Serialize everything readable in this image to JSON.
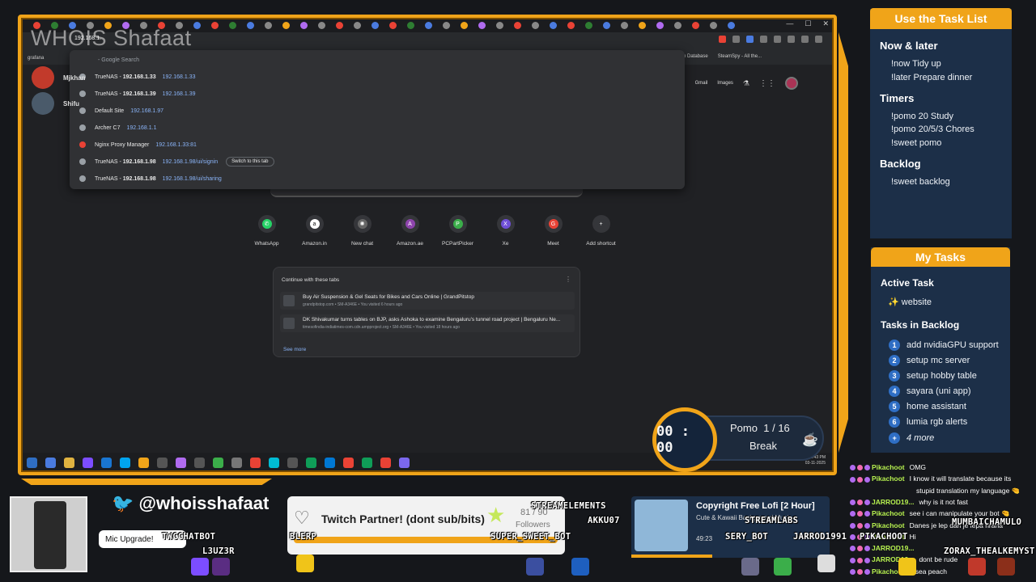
{
  "watermark": "WHOIS Shafaat",
  "omnibox": {
    "query": "192.168.1.",
    "rows": [
      {
        "title": "192.168.1.",
        "url": "",
        "suffix": "- Google Search"
      },
      {
        "title": "TrueNAS",
        "bold": "192.168.1.33",
        "url": "192.168.1.33"
      },
      {
        "title": "TrueNAS",
        "bold": "192.168.1.39",
        "url": "192.168.1.39"
      },
      {
        "title": "Default Site",
        "bold": "",
        "url": "192.168.1.97"
      },
      {
        "title": "Archer C7",
        "bold": "",
        "url": "192.168.1.1"
      },
      {
        "title": "Nginx Proxy Manager",
        "bold": "",
        "url": "192.168.1.33:81"
      },
      {
        "title": "TrueNAS",
        "bold": "192.168.1.98",
        "url": "192.168.1.98/ui/signin",
        "switch": "Switch to this tab"
      },
      {
        "title": "TrueNAS",
        "bold": "192.168.1.98",
        "url": "192.168.1.98/ui/sharing"
      }
    ]
  },
  "profiles": [
    {
      "name": "Mjkhan"
    },
    {
      "name": "Shifu"
    }
  ],
  "bookmark_left": "grafana",
  "bookmarks_right": [
    "n Database",
    "SteamSpy - All the..."
  ],
  "google_links": [
    "Gmail",
    "Images"
  ],
  "shortcuts": [
    {
      "label": "WhatsApp",
      "color": "#25d366",
      "glyph": "✆"
    },
    {
      "label": "Amazon.in",
      "color": "#ffffff",
      "glyph": "a"
    },
    {
      "label": "New chat",
      "color": "#666",
      "glyph": "✺"
    },
    {
      "label": "Amazon.ae",
      "color": "#8e44ad",
      "glyph": "A"
    },
    {
      "label": "PCPartPicker",
      "color": "#3bae4a",
      "glyph": "P"
    },
    {
      "label": "Xe",
      "color": "#6f4fd8",
      "glyph": "X"
    },
    {
      "label": "Meet",
      "color": "#e94235",
      "glyph": "G"
    },
    {
      "label": "Add shortcut",
      "color": "#35363a",
      "glyph": "+"
    }
  ],
  "continue": {
    "title": "Continue with these tabs",
    "items": [
      {
        "title": "Buy Air Suspension & Gel Seats for Bikes and Cars Online | GrandPitstop",
        "sub": "grandpitstop.com • SM-A346E • You visited 6 hours ago"
      },
      {
        "title": "DK Shivakumar turns tables on BJP, asks Ashoka to examine Bengaluru's tunnel road project | Bengaluru Ne...",
        "sub": "timesofindia-indiatimes-com.cdn.ampproject.org • SM-A346E • You visited 18 hours ago"
      }
    ],
    "see_more": "See more"
  },
  "tray": {
    "time": "02:43 PM",
    "date": "03-11-2025",
    "lang": "ENG"
  },
  "pomo": {
    "time": "00 : 00",
    "label": "Pomo",
    "current": "1",
    "sep": "/",
    "total": "16",
    "state": "Break"
  },
  "task_list": {
    "title": "Use the Task List",
    "sections": [
      {
        "name": "Now & later",
        "items": [
          "!now Tidy up",
          "!later Prepare dinner"
        ]
      },
      {
        "name": "Timers",
        "items": [
          "!pomo 20 Study",
          "!pomo 20/5/3 Chores",
          "!sweet pomo"
        ]
      },
      {
        "name": "Backlog",
        "items": [
          "!sweet backlog"
        ]
      }
    ]
  },
  "my_tasks": {
    "title": "My Tasks",
    "active_title": "Active Task",
    "active": "✨ website",
    "backlog_title": "Tasks in Backlog",
    "backlog": [
      {
        "n": "1",
        "t": "add nvidiaGPU support"
      },
      {
        "n": "2",
        "t": "setup mc server"
      },
      {
        "n": "3",
        "t": "setup hobby table"
      },
      {
        "n": "4",
        "t": "sayara (uni app)"
      },
      {
        "n": "5",
        "t": "home assistant"
      },
      {
        "n": "6",
        "t": "lumia rgb alerts"
      }
    ],
    "more": "4 more",
    "more_n": "+"
  },
  "chat": [
    {
      "user": "Pikachoot",
      "msg": "OMG"
    },
    {
      "user": "Pikachoot",
      "msg": "I know it will translate because its"
    },
    {
      "user": "",
      "msg": "stupid translation my language 🤏"
    },
    {
      "user": "JARROD19...",
      "msg": "why is it not fast"
    },
    {
      "user": "Pikachoot",
      "msg": "see i can manipulate your bot 🤏"
    },
    {
      "user": "Pikachoot",
      "msg": "Danes je lep dan je lepa hrana"
    },
    {
      "user": "Pikachoot",
      "msg": "Hi"
    },
    {
      "user": "JARROD19...",
      "msg": ""
    },
    {
      "user": "JARROD19...",
      "msg": "dont be rude"
    },
    {
      "user": "Pikachoot",
      "msg": "a sea peach"
    }
  ],
  "social": {
    "twitter": "@whoisshafaat"
  },
  "mic_upgrade": "Mic Upgrade!",
  "partner": {
    "title": "Twitch Partner! (dont sub/bits)",
    "count": "81 / 90",
    "followers": "Followers"
  },
  "music": {
    "title": "Copyright Free Lofi [2 Hour]",
    "subtitle": "Cute & Kawaii Background Music",
    "time": "49:23"
  },
  "bot_names": [
    "TWCCHATBOT",
    "L3UZ3R",
    "BLERP",
    "STREAMELEMENTS",
    "AKKU07",
    "SUPER_SWEET_BOT",
    "STREAMLABS",
    "SERY_BOT",
    "JARROD1991",
    "PIKACHOOT",
    "MUMBAICHAMULO",
    "ZORAX_THEALKEMYST"
  ],
  "colors": {
    "accent": "#f0a419",
    "panel": "#1c2f48",
    "chrome_bg": "#202124",
    "link": "#8ab4f8"
  }
}
